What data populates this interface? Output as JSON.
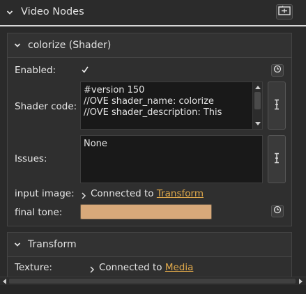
{
  "header": {
    "title": "Video Nodes",
    "action_icon": "add-node-icon"
  },
  "colorize": {
    "title": "colorize (Shader)",
    "enabled_label": "Enabled:",
    "enabled_checked": true,
    "shader_code_label": "Shader code:",
    "shader_code_lines": [
      "#version 150",
      "",
      "//OVE shader_name: colorize",
      "//OVE shader_description: This"
    ],
    "issues_label": "Issues:",
    "issues_value": "None",
    "input_image_label": "input image:",
    "input_image_prefix": "Connected to",
    "input_image_link": "Transform",
    "final_tone_label": "final tone:",
    "final_tone_color": "#d8a97a"
  },
  "transform": {
    "title": "Transform",
    "texture_label": "Texture:",
    "texture_prefix": "Connected to",
    "texture_link": "Media"
  },
  "colors": {
    "link": "#e0a94b",
    "background": "#2a2a2a",
    "panel": "#323232"
  }
}
